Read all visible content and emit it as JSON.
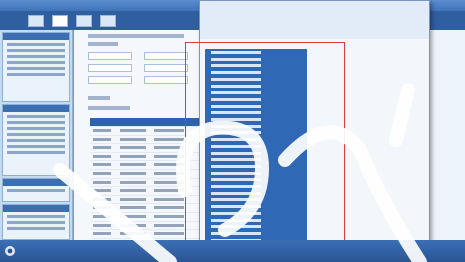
{
  "app": {
    "title": ""
  },
  "menu": {
    "items": [
      "",
      "",
      "",
      ""
    ]
  },
  "sidebar": {
    "sections": [
      {
        "title": "",
        "items": [
          "",
          "",
          "",
          "",
          "",
          ""
        ]
      },
      {
        "title": "",
        "items": [
          "",
          "",
          "",
          "",
          "",
          "",
          ""
        ]
      },
      {
        "title": "",
        "items": [
          ""
        ]
      },
      {
        "title": "",
        "items": [
          "",
          "",
          ""
        ]
      }
    ]
  },
  "dropdown": {
    "highlighted_rows": 30
  },
  "colors": {
    "accent": "#2f69b5",
    "highlight_border": "#e23a3a",
    "watermark": "#ffffff"
  },
  "icons": [
    "app-logo-icon"
  ]
}
